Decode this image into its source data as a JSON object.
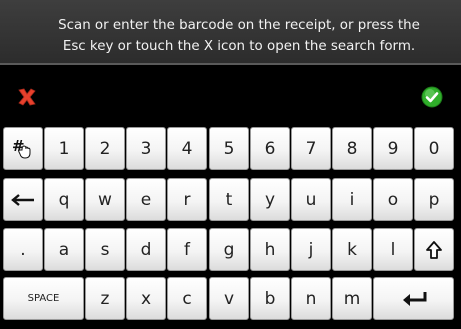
{
  "prompt": {
    "text": "Scan or enter the barcode on the receipt, or press the Esc key or touch the X icon to open the search form."
  },
  "toolbar": {
    "cancel_icon": "red-x-icon",
    "confirm_icon": "green-check-icon",
    "cancel_color": "#e8402c",
    "confirm_color": "#2fae2a"
  },
  "keyboard": {
    "row1": [
      "1",
      "2",
      "3",
      "4",
      "5",
      "6",
      "7",
      "8",
      "9",
      "0"
    ],
    "row2": [
      "q",
      "w",
      "e",
      "r",
      "t",
      "y",
      "u",
      "i",
      "o",
      "p"
    ],
    "row3": [
      ".",
      "a",
      "s",
      "d",
      "f",
      "g",
      "h",
      "j",
      "k",
      "l"
    ],
    "row4": [
      "z",
      "x",
      "c",
      "v",
      "b",
      "n",
      "m"
    ],
    "space_label": "SPACE",
    "symbols_icon": "hash-touch-icon",
    "backspace_icon": "left-arrow-icon",
    "shift_icon": "shift-arrow-icon",
    "enter_icon": "enter-arrow-icon"
  }
}
